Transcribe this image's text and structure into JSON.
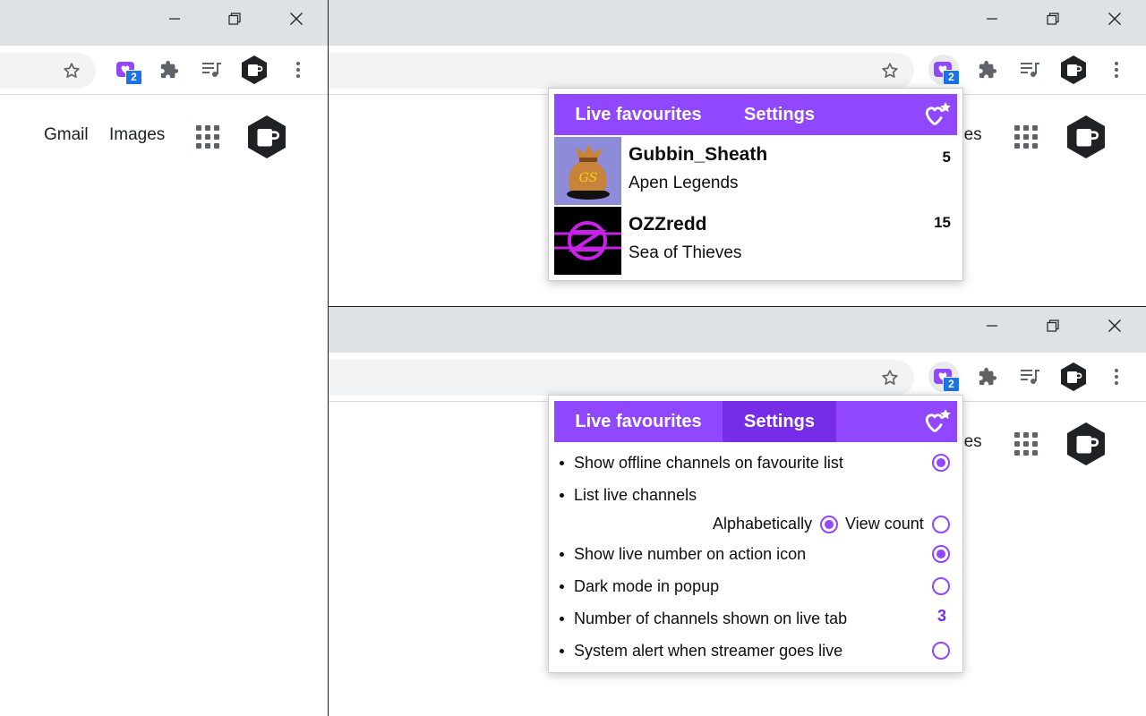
{
  "google_links": {
    "gmail": "Gmail",
    "images": "Images",
    "images_partial": "ges"
  },
  "extension_badge": "2",
  "popup_tabs": {
    "live": "Live favourites",
    "settings": "Settings"
  },
  "live_channels": [
    {
      "name": "Gubbin_Sheath",
      "game": "Apen Legends",
      "viewers": "5"
    },
    {
      "name": "OZZredd",
      "game": "Sea of Thieves",
      "viewers": "15"
    }
  ],
  "settings": {
    "show_offline": {
      "label": "Show offline channels on favourite list",
      "checked": true
    },
    "list_live": {
      "label": "List live channels",
      "alphabetically": "Alphabetically",
      "view_count": "View count",
      "selected": "Alphabetically"
    },
    "show_number": {
      "label": "Show live number on action icon",
      "checked": true
    },
    "dark_mode": {
      "label": "Dark mode in popup",
      "checked": false
    },
    "num_channels": {
      "label": "Number of channels shown on live tab",
      "value": "3"
    },
    "system_alert": {
      "label": "System alert when streamer goes live",
      "checked": false
    }
  },
  "colors": {
    "brand_purple": "#9146ff",
    "tab_selected": "#772ce8",
    "titlebar": "#dee1e6",
    "badge_blue": "#1a73e8"
  },
  "icons": [
    "minimize-icon",
    "restore-icon",
    "close-icon",
    "star-icon",
    "live-favourites-extension-icon",
    "puzzle-icon",
    "media-queue-icon",
    "coffee-hexagon-icon",
    "more-vert-icon",
    "apps-grid-icon",
    "heart-star-icon"
  ]
}
